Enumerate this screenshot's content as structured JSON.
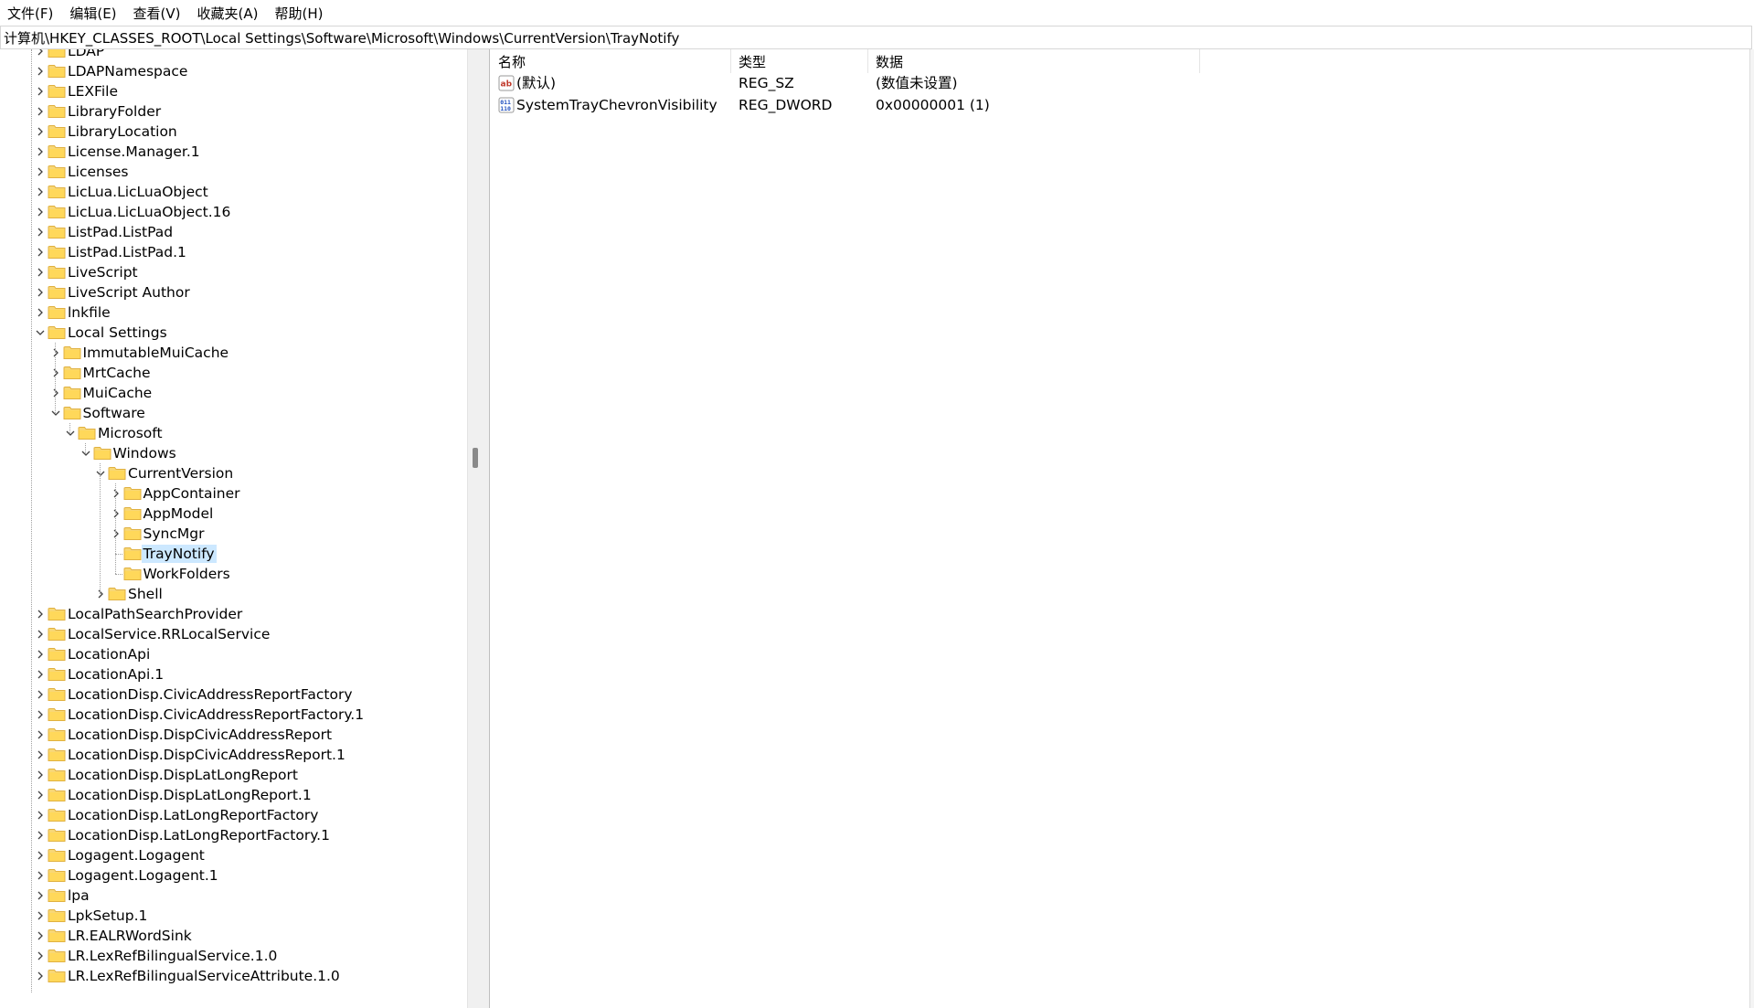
{
  "menu": [
    {
      "name": "file",
      "label": "文件(F)"
    },
    {
      "name": "edit",
      "label": "编辑(E)"
    },
    {
      "name": "view",
      "label": "查看(V)"
    },
    {
      "name": "favorites",
      "label": "收藏夹(A)"
    },
    {
      "name": "help",
      "label": "帮助(H)"
    }
  ],
  "address": "计算机\\HKEY_CLASSES_ROOT\\Local Settings\\Software\\Microsoft\\Windows\\CurrentVersion\\TrayNotify",
  "tree": [
    {
      "label": "LDAP",
      "level": 0,
      "expander": "collapsed"
    },
    {
      "label": "LDAPNamespace",
      "level": 0,
      "expander": "collapsed"
    },
    {
      "label": "LEXFile",
      "level": 0,
      "expander": "collapsed"
    },
    {
      "label": "LibraryFolder",
      "level": 0,
      "expander": "collapsed"
    },
    {
      "label": "LibraryLocation",
      "level": 0,
      "expander": "collapsed"
    },
    {
      "label": "License.Manager.1",
      "level": 0,
      "expander": "collapsed"
    },
    {
      "label": "Licenses",
      "level": 0,
      "expander": "collapsed"
    },
    {
      "label": "LicLua.LicLuaObject",
      "level": 0,
      "expander": "collapsed"
    },
    {
      "label": "LicLua.LicLuaObject.16",
      "level": 0,
      "expander": "collapsed"
    },
    {
      "label": "ListPad.ListPad",
      "level": 0,
      "expander": "collapsed"
    },
    {
      "label": "ListPad.ListPad.1",
      "level": 0,
      "expander": "collapsed"
    },
    {
      "label": "LiveScript",
      "level": 0,
      "expander": "collapsed"
    },
    {
      "label": "LiveScript Author",
      "level": 0,
      "expander": "collapsed"
    },
    {
      "label": "lnkfile",
      "level": 0,
      "expander": "collapsed"
    },
    {
      "label": "Local Settings",
      "level": 0,
      "expander": "expanded"
    },
    {
      "label": "ImmutableMuiCache",
      "level": 1,
      "expander": "collapsed"
    },
    {
      "label": "MrtCache",
      "level": 1,
      "expander": "collapsed"
    },
    {
      "label": "MuiCache",
      "level": 1,
      "expander": "collapsed"
    },
    {
      "label": "Software",
      "level": 1,
      "expander": "expanded"
    },
    {
      "label": "Microsoft",
      "level": 2,
      "expander": "expanded"
    },
    {
      "label": "Windows",
      "level": 3,
      "expander": "expanded"
    },
    {
      "label": "CurrentVersion",
      "level": 4,
      "expander": "expanded"
    },
    {
      "label": "AppContainer",
      "level": 5,
      "expander": "collapsed"
    },
    {
      "label": "AppModel",
      "level": 5,
      "expander": "collapsed"
    },
    {
      "label": "SyncMgr",
      "level": 5,
      "expander": "collapsed"
    },
    {
      "label": "TrayNotify",
      "level": 5,
      "expander": "none",
      "selected": true
    },
    {
      "label": "WorkFolders",
      "level": 5,
      "expander": "none"
    },
    {
      "label": "Shell",
      "level": 4,
      "expander": "collapsed"
    },
    {
      "label": "LocalPathSearchProvider",
      "level": 0,
      "expander": "collapsed"
    },
    {
      "label": "LocalService.RRLocalService",
      "level": 0,
      "expander": "collapsed"
    },
    {
      "label": "LocationApi",
      "level": 0,
      "expander": "collapsed"
    },
    {
      "label": "LocationApi.1",
      "level": 0,
      "expander": "collapsed"
    },
    {
      "label": "LocationDisp.CivicAddressReportFactory",
      "level": 0,
      "expander": "collapsed"
    },
    {
      "label": "LocationDisp.CivicAddressReportFactory.1",
      "level": 0,
      "expander": "collapsed"
    },
    {
      "label": "LocationDisp.DispCivicAddressReport",
      "level": 0,
      "expander": "collapsed"
    },
    {
      "label": "LocationDisp.DispCivicAddressReport.1",
      "level": 0,
      "expander": "collapsed"
    },
    {
      "label": "LocationDisp.DispLatLongReport",
      "level": 0,
      "expander": "collapsed"
    },
    {
      "label": "LocationDisp.DispLatLongReport.1",
      "level": 0,
      "expander": "collapsed"
    },
    {
      "label": "LocationDisp.LatLongReportFactory",
      "level": 0,
      "expander": "collapsed"
    },
    {
      "label": "LocationDisp.LatLongReportFactory.1",
      "level": 0,
      "expander": "collapsed"
    },
    {
      "label": "Logagent.Logagent",
      "level": 0,
      "expander": "collapsed"
    },
    {
      "label": "Logagent.Logagent.1",
      "level": 0,
      "expander": "collapsed"
    },
    {
      "label": "lpa",
      "level": 0,
      "expander": "collapsed"
    },
    {
      "label": "LpkSetup.1",
      "level": 0,
      "expander": "collapsed"
    },
    {
      "label": "LR.EALRWordSink",
      "level": 0,
      "expander": "collapsed"
    },
    {
      "label": "LR.LexRefBilingualService.1.0",
      "level": 0,
      "expander": "collapsed"
    },
    {
      "label": "LR.LexRefBilingualServiceAttribute.1.0",
      "level": 0,
      "expander": "collapsed"
    }
  ],
  "columns": {
    "name": "名称",
    "type": "类型",
    "data": "数据"
  },
  "values": [
    {
      "icon": "string-value-icon",
      "name": "(默认)",
      "type": "REG_SZ",
      "data": "(数值未设置)"
    },
    {
      "icon": "binary-value-icon",
      "name": "SystemTrayChevronVisibility",
      "type": "REG_DWORD",
      "data": "0x00000001 (1)"
    }
  ],
  "colors": {
    "selection": "#cce8ff",
    "folder": "#f8d775",
    "folder_dark": "#e0b141"
  }
}
